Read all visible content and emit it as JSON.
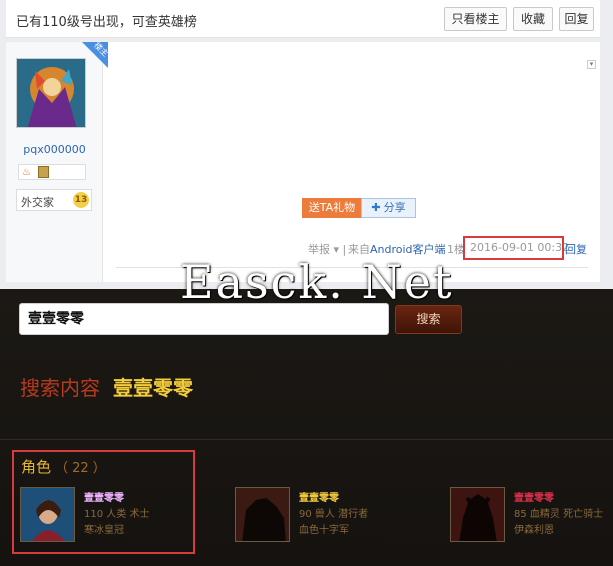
{
  "forum": {
    "thread_title": "已有110级号出现，可查英雄榜",
    "buttons": {
      "only_op": "只看楼主",
      "favorite": "收藏",
      "reply": "回复"
    },
    "post": {
      "corner_badge": "楼主",
      "username": "pqx000000",
      "group_label": "外交家",
      "level": "13",
      "gift_button": "送TA礼物",
      "share_button": "分享",
      "report": "举报",
      "source": "来自Android客户端",
      "floor": "1楼",
      "date": "2016-09-01 00:32",
      "reply": "回复"
    }
  },
  "watermark": "Easck. Net",
  "armory": {
    "search_value": "壹壹零零",
    "search_button": "搜索",
    "results_label": "搜索内容",
    "results_term": "壹壹零零",
    "section_title": "角色",
    "section_count": "（ 22 ）",
    "characters": [
      {
        "name": "壹壹零零",
        "info": "110 人类 术士",
        "realm": "寒冰皇冠",
        "name_color": "#f0b4ff"
      },
      {
        "name": "壹壹零零",
        "info": "90 兽人 潜行者",
        "realm": "血色十字军",
        "name_color": "#f4cd3c"
      },
      {
        "name": "壹壹零零",
        "info": "85 血精灵 死亡骑士",
        "realm": "伊森利恩",
        "name_color": "#d8304a"
      }
    ]
  }
}
